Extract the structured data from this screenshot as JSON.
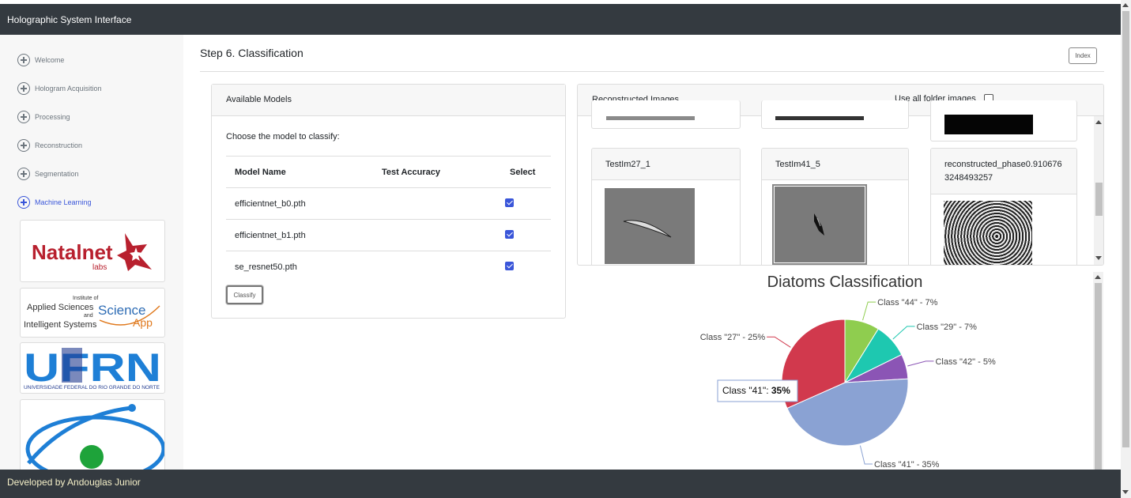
{
  "app": {
    "title": "Holographic System Interface",
    "footer": "Developed by Andouglas Junior"
  },
  "sidebar": {
    "items": [
      {
        "label": "Welcome",
        "active": false
      },
      {
        "label": "Hologram Acquisition",
        "active": false
      },
      {
        "label": "Processing",
        "active": false
      },
      {
        "label": "Reconstruction",
        "active": false
      },
      {
        "label": "Segmentation",
        "active": false
      },
      {
        "label": "Machine Learning",
        "active": true
      }
    ],
    "logos": {
      "natalnet": {
        "name": "Natalnet",
        "sub": "labs"
      },
      "iasis": {
        "line1": "Institute of",
        "line2": "Applied Sciences",
        "line3": "and",
        "line4": "Intelligent Systems",
        "science": "Science",
        "app": "App"
      },
      "ufrn": {
        "name": "UFRN",
        "sub": "UNIVERSIDADE FEDERAL DO RIO GRANDE DO NORTE"
      }
    }
  },
  "header": {
    "step_title": "Step 6. Classification",
    "index_button": "Index"
  },
  "models": {
    "card_title": "Available Models",
    "prompt": "Choose the model to classify:",
    "columns": [
      "Model Name",
      "Test Accuracy",
      "Select"
    ],
    "rows": [
      {
        "name": "efficientnet_b0.pth",
        "accuracy": "",
        "selected": true
      },
      {
        "name": "efficientnet_b1.pth",
        "accuracy": "",
        "selected": true
      },
      {
        "name": "se_resnet50.pth",
        "accuracy": "",
        "selected": true
      }
    ],
    "classify_button": "Classify"
  },
  "reconstructed": {
    "card_title": "Reconstructed Images",
    "use_all_label": "Use all folder images",
    "use_all_checked": false,
    "images": [
      {
        "label": "TestIm27_1"
      },
      {
        "label": "TestIm41_5"
      },
      {
        "label": "reconstructed_phase0.9106763248493257"
      }
    ]
  },
  "colors": {
    "class27": "#d1394d",
    "class44": "#8fcd4f",
    "class29": "#1ec8b0",
    "class42": "#8b55b5",
    "class41": "#8aa2d3",
    "accent": "#3a56d9"
  },
  "chart_data": {
    "type": "pie",
    "title": "Diatoms Classification",
    "slices": [
      {
        "label": "Class \"44\" - 7%",
        "category": "Class \"44\"",
        "value": 7,
        "color": "#8fcd4f"
      },
      {
        "label": "Class \"29\" - 7%",
        "category": "Class \"29\"",
        "value": 7,
        "color": "#1ec8b0"
      },
      {
        "label": "Class \"42\" - 5%",
        "category": "Class \"42\"",
        "value": 5,
        "color": "#8b55b5"
      },
      {
        "label": "Class \"41\" - 35%",
        "category": "Class \"41\"",
        "value": 35,
        "color": "#8aa2d3"
      },
      {
        "label": "Class \"27\" - 25%",
        "category": "Class \"27\"",
        "value": 25,
        "color": "#d1394d"
      }
    ],
    "tooltip": {
      "prefix": "Class \"41\": ",
      "value": "35%"
    }
  }
}
